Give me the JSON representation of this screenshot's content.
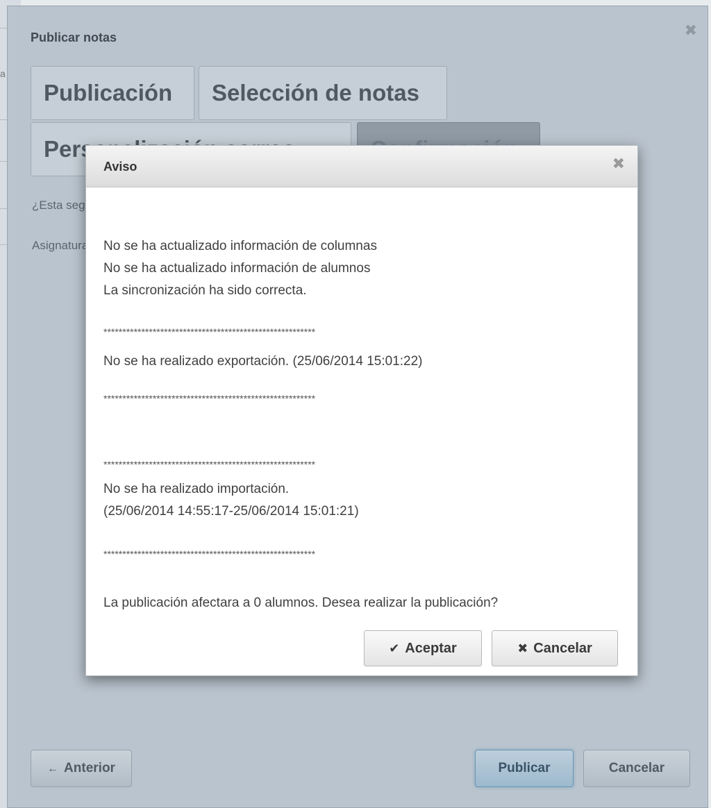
{
  "background": {
    "fragment_char": "a"
  },
  "outer_dialog": {
    "title": "Publicar notas",
    "close_icon": "close-icon",
    "tabs": [
      {
        "label": "Publicación"
      },
      {
        "label": "Selección de notas"
      },
      {
        "label": "Personalización correo"
      },
      {
        "label": "Confirmación"
      }
    ],
    "question_text": "¿Esta seguro de publicar las notas?",
    "asignaturas_label": "Asignaturas",
    "buttons": {
      "anterior": "Anterior",
      "publicar": "Publicar",
      "cancelar": "Cancelar"
    }
  },
  "modal": {
    "title": "Aviso",
    "lines": [
      "No se ha actualizado información de columnas",
      "No se ha actualizado información de alumnos",
      "La sincronización ha sido correcta.",
      "********************************************************",
      "No se ha realizado exportación. (25/06/2014 15:01:22)",
      "********************************************************",
      "********************************************************",
      "No se ha realizado importación.",
      "(25/06/2014 14:55:17-25/06/2014 15:01:21)",
      "********************************************************",
      "La publicación afectara a 0 alumnos. Desea realizar la publicación?"
    ],
    "buttons": {
      "aceptar": "Aceptar",
      "cancelar": "Cancelar"
    }
  },
  "colors": {
    "outer_bg": "#c4ced6",
    "publicar_accent": "#9fbfd5"
  }
}
